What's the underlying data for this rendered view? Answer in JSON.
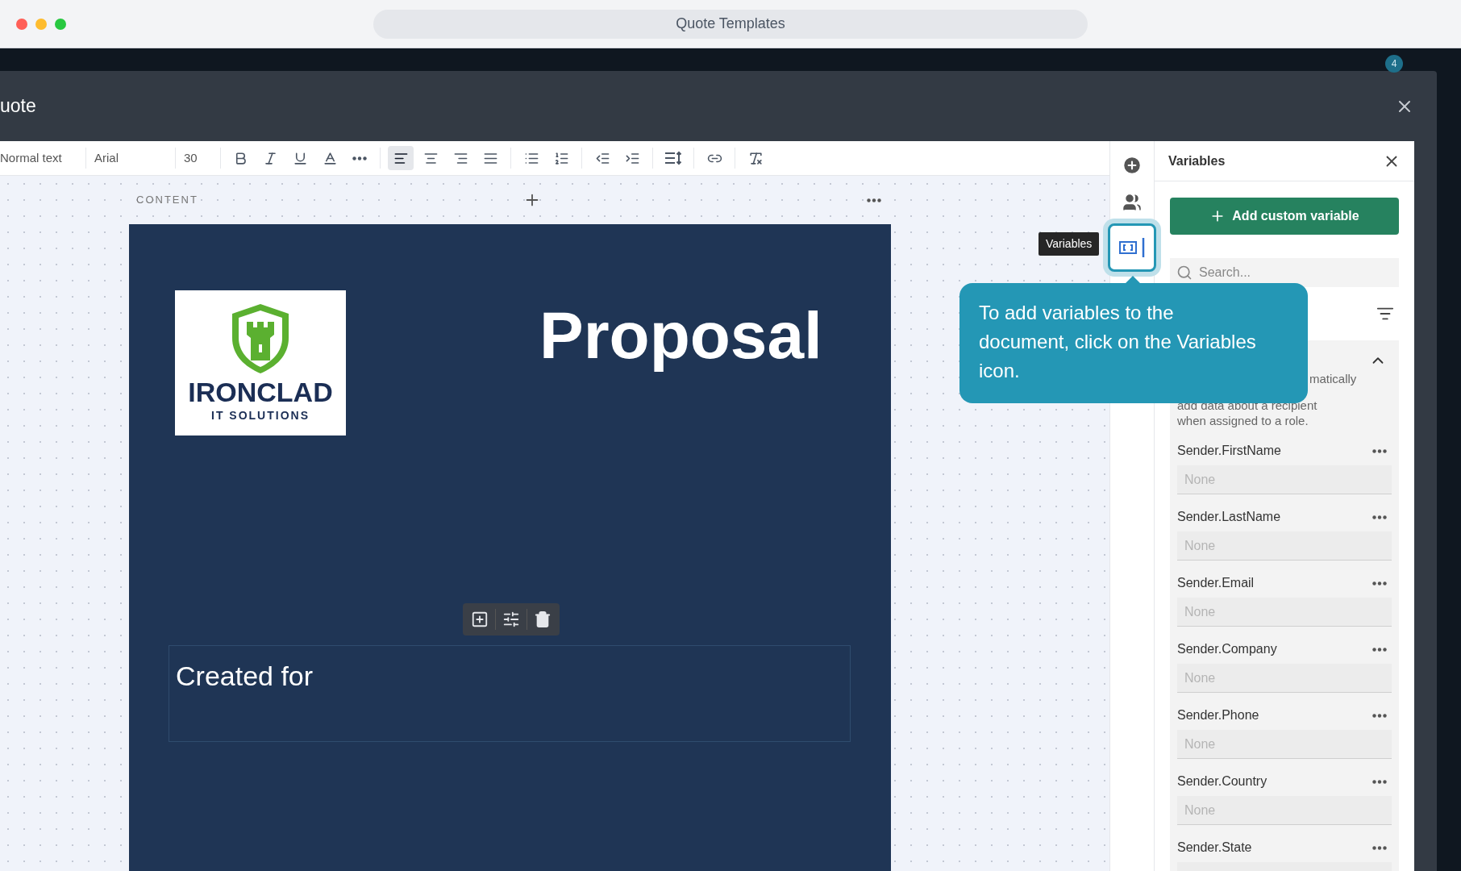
{
  "window": {
    "title": "Quote Templates"
  },
  "header_badge": "4",
  "modal": {
    "title": "uote"
  },
  "toolbar": {
    "style": "Normal text",
    "font": "Arial",
    "size": "30",
    "buttons": [
      {
        "kind": "bold",
        "selected": false
      },
      {
        "kind": "italic",
        "selected": false
      },
      {
        "kind": "underline",
        "selected": false
      },
      {
        "kind": "color",
        "selected": false
      },
      {
        "kind": "more",
        "selected": false
      },
      {
        "kind": "sep"
      },
      {
        "kind": "align-left",
        "selected": true
      },
      {
        "kind": "align-center",
        "selected": false
      },
      {
        "kind": "align-right",
        "selected": false
      },
      {
        "kind": "justify",
        "selected": false
      },
      {
        "kind": "sep"
      },
      {
        "kind": "bullets",
        "selected": false
      },
      {
        "kind": "numbers",
        "selected": false
      },
      {
        "kind": "sep"
      },
      {
        "kind": "outdent",
        "selected": false
      },
      {
        "kind": "indent",
        "selected": false
      },
      {
        "kind": "sep"
      },
      {
        "kind": "spacing",
        "selected": false
      },
      {
        "kind": "sep"
      },
      {
        "kind": "link",
        "selected": false
      },
      {
        "kind": "sep"
      },
      {
        "kind": "clear",
        "selected": false
      }
    ]
  },
  "canvas": {
    "section_label": "CONTENT"
  },
  "document": {
    "logo": {
      "name": "IRONCLAD",
      "tagline": "IT SOLUTIONS"
    },
    "title": "Proposal",
    "created_for": "Created for"
  },
  "rail": {
    "items": [
      {
        "kind": "add",
        "selected": false
      },
      {
        "kind": "people",
        "selected": false
      },
      {
        "kind": "variables",
        "selected": true
      }
    ]
  },
  "tooltip": "Variables",
  "popover": "To add variables to the document, click on the Variables icon.",
  "panel": {
    "title": "Variables",
    "add_button": "Add custom variable",
    "search": {
      "placeholder": "Search..."
    },
    "section": {
      "expanded": true,
      "description": [
        "matically",
        "add data about a recipient",
        "when assigned to a role."
      ]
    },
    "variables": [
      {
        "name": "Sender.FirstName",
        "placeholder": "None"
      },
      {
        "name": "Sender.LastName",
        "placeholder": "None"
      },
      {
        "name": "Sender.Email",
        "placeholder": "None"
      },
      {
        "name": "Sender.Company",
        "placeholder": "None"
      },
      {
        "name": "Sender.Phone",
        "placeholder": "None"
      },
      {
        "name": "Sender.Country",
        "placeholder": "None"
      },
      {
        "name": "Sender.State"
      }
    ]
  }
}
